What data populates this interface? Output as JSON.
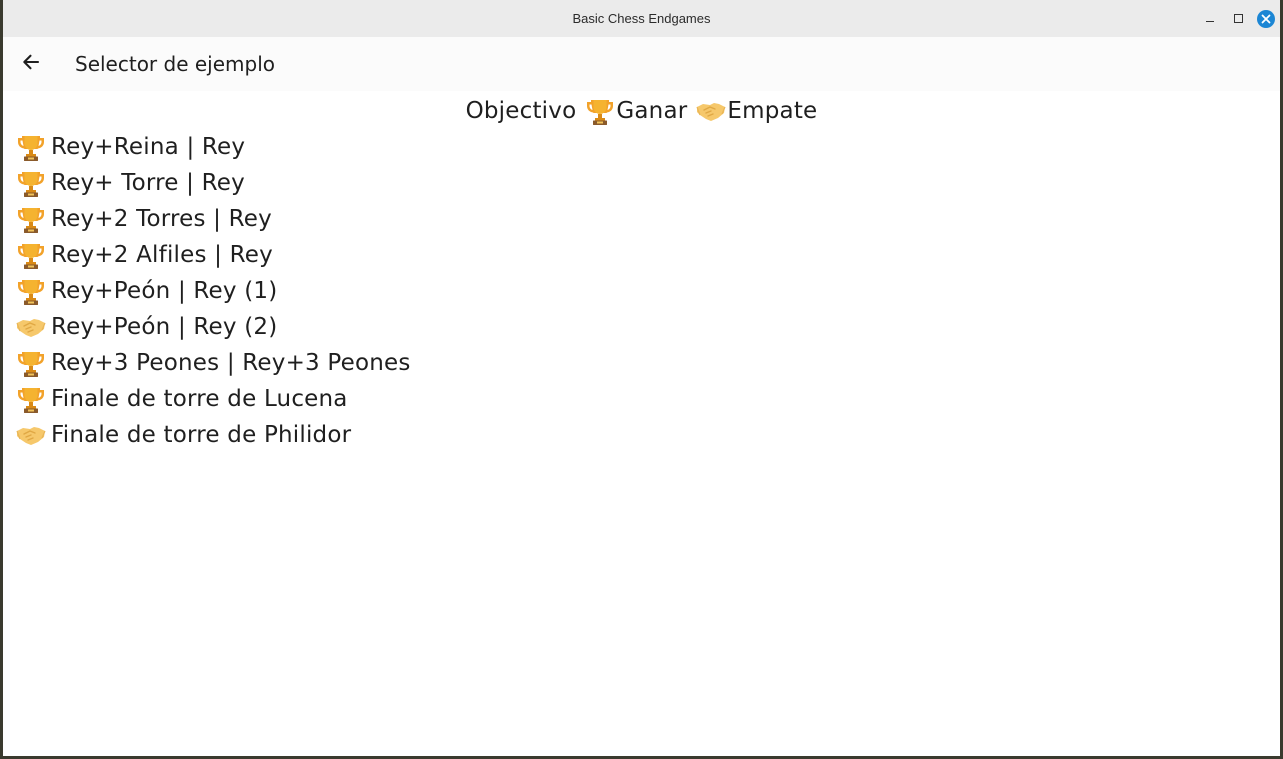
{
  "window": {
    "title": "Basic Chess Endgames"
  },
  "appbar": {
    "title": "Selector de ejemplo",
    "back_icon": "arrow-left-icon"
  },
  "legend": {
    "label": "Objectivo",
    "win_label": "Ganar",
    "draw_label": "Empate",
    "win_icon": "trophy-icon",
    "draw_icon": "handshake-icon"
  },
  "examples": [
    {
      "goal": "win",
      "label": "Rey+Reina | Rey"
    },
    {
      "goal": "win",
      "label": "Rey+ Torre | Rey"
    },
    {
      "goal": "win",
      "label": "Rey+2 Torres | Rey"
    },
    {
      "goal": "win",
      "label": "Rey+2 Alfiles | Rey"
    },
    {
      "goal": "win",
      "label": "Rey+Peón | Rey (1)"
    },
    {
      "goal": "draw",
      "label": "Rey+Peón | Rey (2)"
    },
    {
      "goal": "win",
      "label": "Rey+3 Peones | Rey+3 Peones"
    },
    {
      "goal": "win",
      "label": "Finale de torre de Lucena"
    },
    {
      "goal": "draw",
      "label": "Finale de torre de Philidor"
    }
  ],
  "colors": {
    "trophy": "#f2a22a",
    "handshake": "#f6c86b",
    "close_button": "#1c86d4"
  }
}
